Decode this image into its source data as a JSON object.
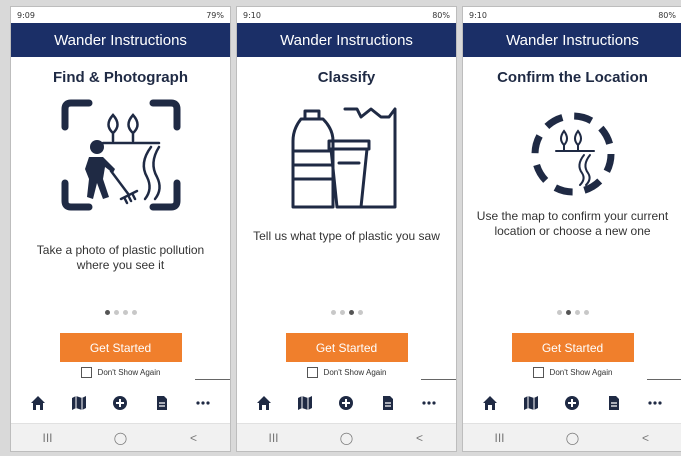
{
  "app": {
    "title": "Wander Instructions",
    "colors": {
      "header": "#1b2f67",
      "accent": "#f07f2c",
      "icon": "#1f2a44"
    },
    "cta_label": "Get Started",
    "dont_show_label": "Don't Show Again"
  },
  "screens": [
    {
      "status": {
        "time": "9:09",
        "battery": "79%"
      },
      "heading": "Find & Photograph",
      "description": "Take a photo of plastic pollution where you see it",
      "active_step": 1,
      "illustration": "person-picking-litter-icon"
    },
    {
      "status": {
        "time": "9:10",
        "battery": "80%"
      },
      "heading": "Classify",
      "description": "Tell us what type of plastic you saw",
      "active_step": 3,
      "illustration": "plastic-containers-icon"
    },
    {
      "status": {
        "time": "9:10",
        "battery": "80%"
      },
      "heading": "Confirm the Location",
      "description": "Use the map to confirm your current location or choose a new one",
      "active_step": 2,
      "illustration": "location-target-icon"
    }
  ],
  "bottom_tabs": [
    {
      "icon": "home-icon"
    },
    {
      "icon": "map-icon"
    },
    {
      "icon": "add-icon"
    },
    {
      "icon": "document-icon"
    },
    {
      "icon": "more-icon"
    }
  ],
  "system_nav": {
    "recent": "III",
    "home": "◯",
    "back": "<"
  }
}
